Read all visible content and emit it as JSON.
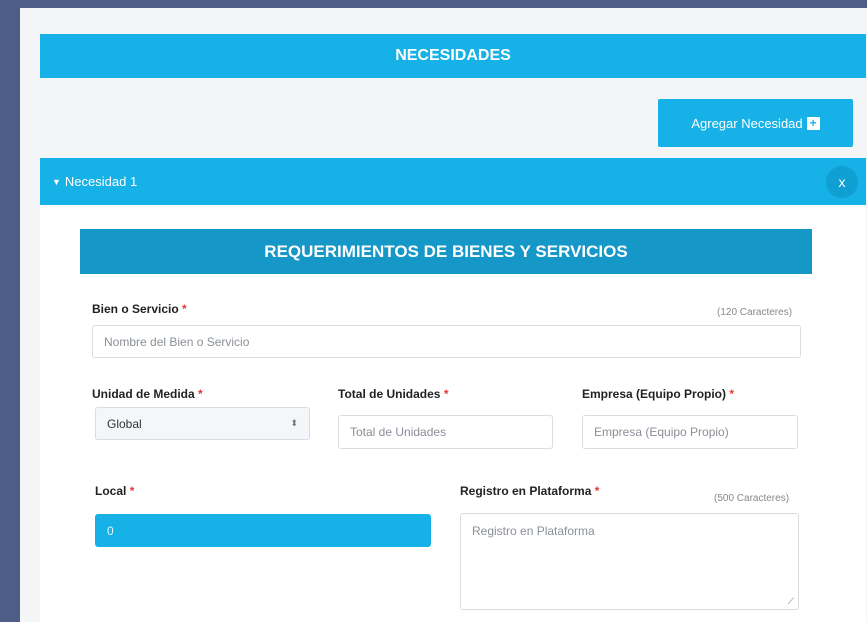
{
  "section": {
    "title": "NECESIDADES"
  },
  "add_button": {
    "label": "Agregar Necesidad",
    "icon": "plus-square-icon"
  },
  "accordion": {
    "title": "Necesidad 1",
    "close_label": "x"
  },
  "form": {
    "title": "REQUERIMIENTOS DE BIENES Y SERVICIOS",
    "required_mark": "*",
    "bien_servicio": {
      "label": "Bien o Servicio",
      "counter": "(120 Caracteres)",
      "placeholder": "Nombre del Bien o Servicio"
    },
    "unidad_medida": {
      "label": "Unidad de Medida",
      "value": "Global"
    },
    "total_unidades": {
      "label": "Total de Unidades",
      "placeholder": "Total de Unidades"
    },
    "empresa": {
      "label": "Empresa (Equipo Propio)",
      "placeholder": "Empresa (Equipo Propio)"
    },
    "local": {
      "label": "Local",
      "value": "0"
    },
    "registro": {
      "label": "Registro en Plataforma",
      "counter": "(500 Caracteres)",
      "placeholder": "Registro en Plataforma"
    }
  },
  "colors": {
    "accent": "#16b1e6",
    "header_dark": "#1597c8",
    "required": "#e53935",
    "frame": "#4d5d87"
  }
}
